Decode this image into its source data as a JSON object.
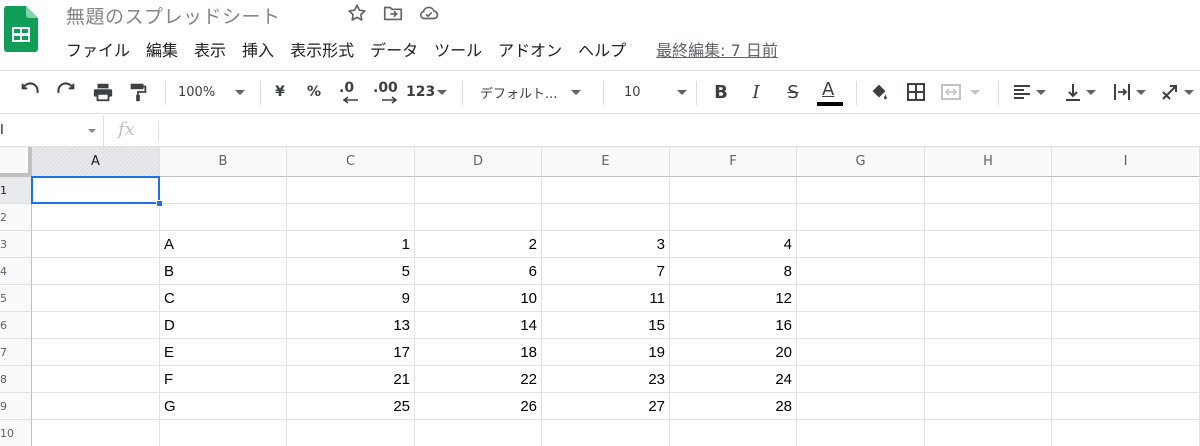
{
  "app": {
    "title": "無題のスプレッドシート",
    "brand_color": "#0f9d58"
  },
  "title_icons": [
    "star-icon",
    "move-to-folder-icon",
    "cloud-status-icon"
  ],
  "menu": {
    "items": [
      {
        "label": "ファイル"
      },
      {
        "label": "編集"
      },
      {
        "label": "表示"
      },
      {
        "label": "挿入"
      },
      {
        "label": "表示形式"
      },
      {
        "label": "データ"
      },
      {
        "label": "ツール"
      },
      {
        "label": "アドオン"
      },
      {
        "label": "ヘルプ"
      }
    ],
    "last_edit": "最終編集: 7 日前"
  },
  "toolbar": {
    "zoom": "100%",
    "currency": "¥",
    "percent": "%",
    "decimal_decrease": ".0",
    "decimal_increase": ".00",
    "more_formats": "123",
    "font": "デフォルト...",
    "font_size": "10",
    "bold": "B",
    "italic": "I",
    "strike": "S",
    "text_color": "A",
    "text_color_value": "#000000"
  },
  "formula_bar": {
    "cell_ref": "I",
    "fx": "fx",
    "value": ""
  },
  "sheet": {
    "columns": [
      "A",
      "B",
      "C",
      "D",
      "E",
      "F",
      "G",
      "H",
      "I"
    ],
    "selected_column": "A",
    "selected_row": "1",
    "row_numbers": [
      "1",
      "2",
      "3",
      "4",
      "5",
      "6",
      "7",
      "8",
      "9",
      "10"
    ],
    "rows": [
      [
        "",
        "",
        "",
        "",
        "",
        "",
        "",
        "",
        ""
      ],
      [
        "",
        "",
        "",
        "",
        "",
        "",
        "",
        "",
        ""
      ],
      [
        "",
        "A",
        "1",
        "2",
        "3",
        "4",
        "",
        "",
        ""
      ],
      [
        "",
        "B",
        "5",
        "6",
        "7",
        "8",
        "",
        "",
        ""
      ],
      [
        "",
        "C",
        "9",
        "10",
        "11",
        "12",
        "",
        "",
        ""
      ],
      [
        "",
        "D",
        "13",
        "14",
        "15",
        "16",
        "",
        "",
        ""
      ],
      [
        "",
        "E",
        "17",
        "18",
        "19",
        "20",
        "",
        "",
        ""
      ],
      [
        "",
        "F",
        "21",
        "22",
        "23",
        "24",
        "",
        "",
        ""
      ],
      [
        "",
        "G",
        "25",
        "26",
        "27",
        "28",
        "",
        "",
        ""
      ],
      [
        "",
        "",
        "",
        "",
        "",
        "",
        "",
        "",
        ""
      ]
    ],
    "selection_color": "#1a73e8"
  }
}
